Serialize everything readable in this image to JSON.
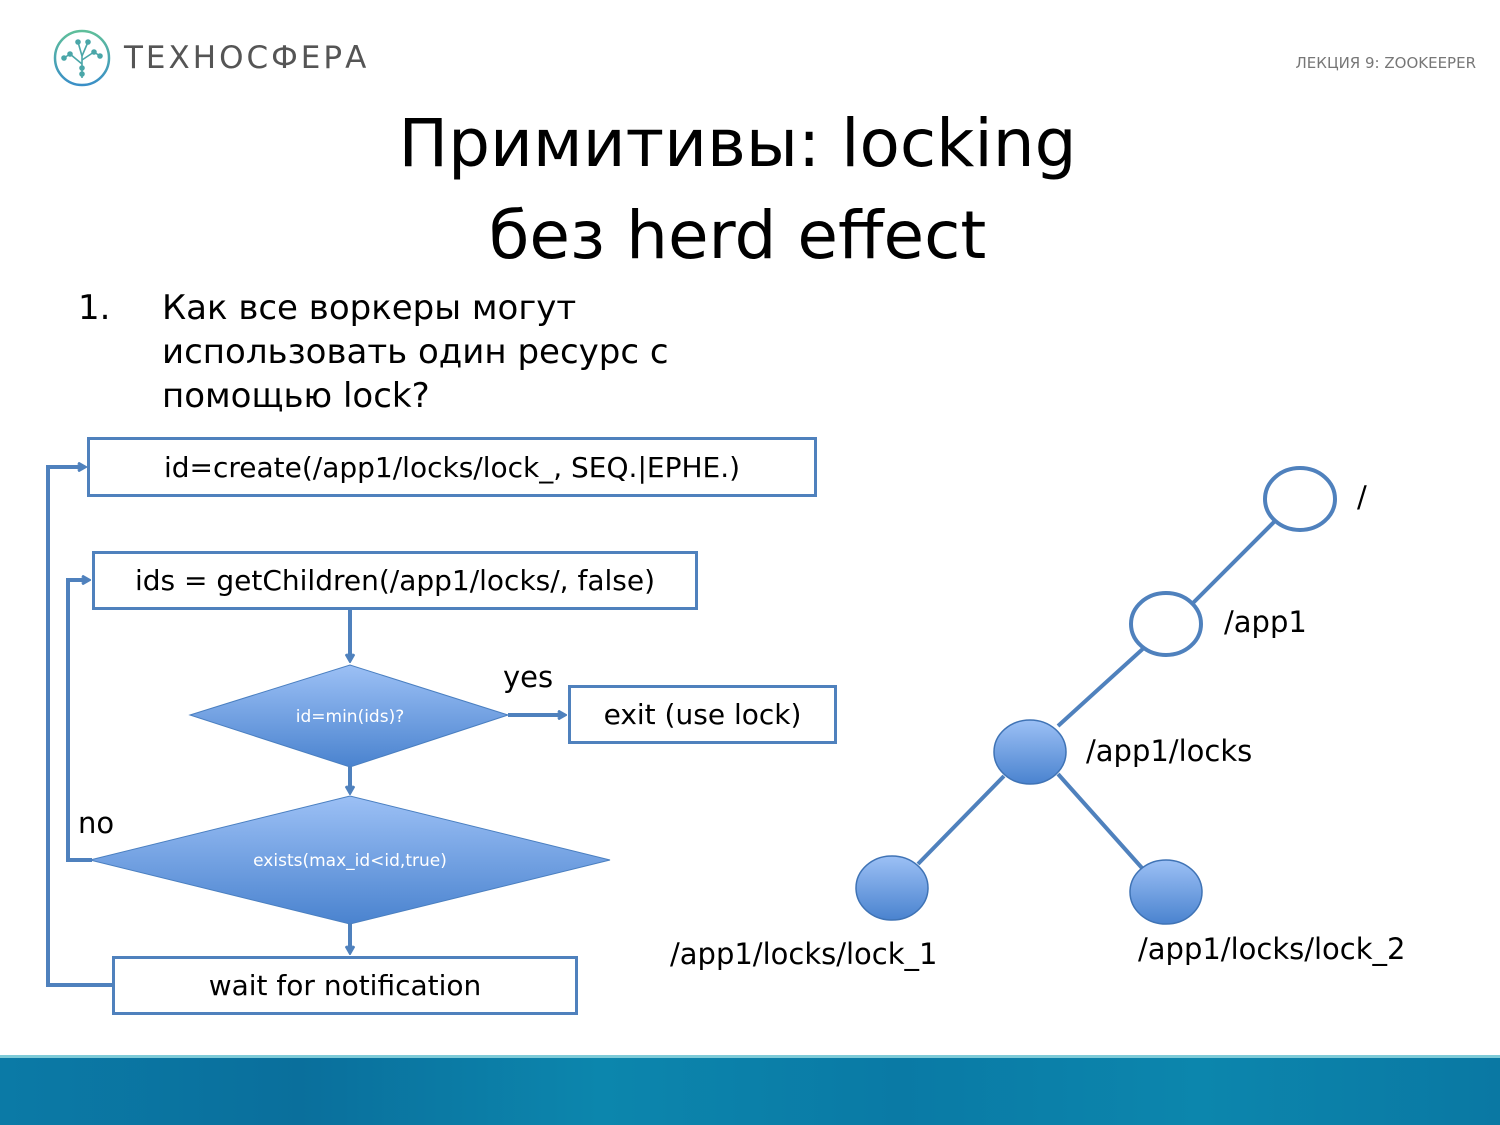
{
  "header": {
    "brand": "ТЕХНОСФЕРА",
    "lecture": "ЛЕКЦИЯ 9: ZOOKEEPER"
  },
  "title": {
    "line1": "Примитивы: locking",
    "line2": "без herd effect"
  },
  "bullet": {
    "number": "1.",
    "text": "Как все воркеры могут использовать один ресурс с помощью lock?"
  },
  "flowchart": {
    "create": "id=create(/app1/locks/lock_, SEQ.|EPHE.)",
    "get_children": "ids = getChildren(/app1/locks/, false)",
    "decision_min": "id=min(ids)?",
    "yes_label": "yes",
    "exit": "exit (use lock)",
    "decision_exists": "exists(max_id<id,true)",
    "no_label": "no",
    "wait": "wait for notification"
  },
  "tree": {
    "nodes": [
      {
        "label": "/",
        "filled": false
      },
      {
        "label": "/app1",
        "filled": false
      },
      {
        "label": "/app1/locks",
        "filled": true
      },
      {
        "label": "/app1/locks/lock_1",
        "filled": true
      },
      {
        "label": "/app1/locks/lock_2",
        "filled": true
      }
    ]
  },
  "colors": {
    "accent": "#4f81bd",
    "node_fill_top": "#9cc0f5",
    "node_fill_bottom": "#4a83cf",
    "footer": "#0b7aa6"
  }
}
